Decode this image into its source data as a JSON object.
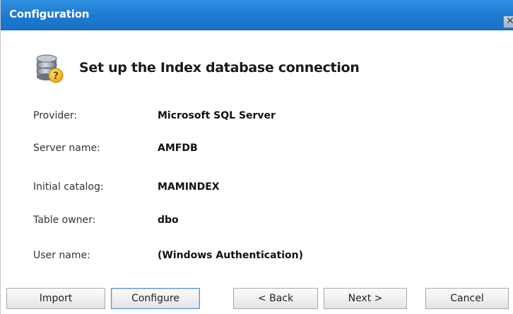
{
  "window": {
    "title": "Configuration",
    "close_symbol": "✕"
  },
  "header": {
    "icon": "database-help-icon",
    "heading": "Set up the Index database connection"
  },
  "details": [
    {
      "label": "Provider:",
      "value": "Microsoft SQL Server"
    },
    {
      "label": "Server name:",
      "value": "AMFDB"
    },
    {
      "label": "Initial catalog:",
      "value": "MAMINDEX"
    },
    {
      "label": "Table owner:",
      "value": "dbo"
    },
    {
      "label": "User name:",
      "value": "(Windows Authentication)"
    }
  ],
  "buttons": {
    "import": "Import",
    "configure": "Configure",
    "back": "< Back",
    "next": "Next >",
    "cancel": "Cancel"
  },
  "colors": {
    "titlebar": "#1d7ad0",
    "title_text": "#ffffff",
    "icon_badge": "#f5b700"
  }
}
